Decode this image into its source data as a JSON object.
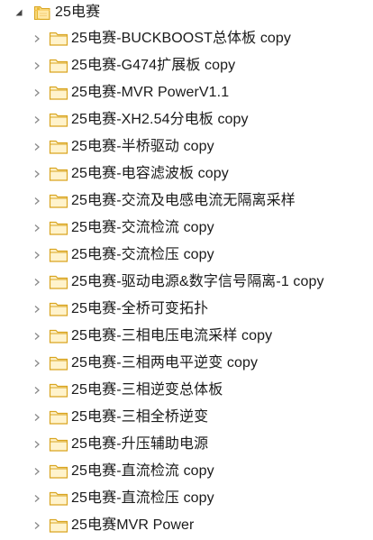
{
  "tree": {
    "root": {
      "label": "25电赛",
      "expanded": true,
      "icon": "folder-open-icon"
    },
    "children": [
      {
        "label": "25电赛-BUCKBOOST总体板 copy"
      },
      {
        "label": "25电赛-G474扩展板 copy"
      },
      {
        "label": "25电赛-MVR PowerV1.1"
      },
      {
        "label": "25电赛-XH2.54分电板 copy"
      },
      {
        "label": "25电赛-半桥驱动 copy"
      },
      {
        "label": "25电赛-电容滤波板 copy"
      },
      {
        "label": "25电赛-交流及电感电流无隔离采样"
      },
      {
        "label": "25电赛-交流检流 copy"
      },
      {
        "label": "25电赛-交流检压 copy"
      },
      {
        "label": "25电赛-驱动电源&数字信号隔离-1 copy"
      },
      {
        "label": "25电赛-全桥可变拓扑"
      },
      {
        "label": "25电赛-三相电压电流采样 copy"
      },
      {
        "label": "25电赛-三相两电平逆变 copy"
      },
      {
        "label": "25电赛-三相逆变总体板"
      },
      {
        "label": "25电赛-三相全桥逆变"
      },
      {
        "label": "25电赛-升压辅助电源"
      },
      {
        "label": "25电赛-直流检流 copy"
      },
      {
        "label": "25电赛-直流检压 copy"
      },
      {
        "label": "25电赛MVR Power"
      }
    ],
    "colors": {
      "text": "#1a1a1a",
      "expander": "#8a8a8a",
      "folder_fill": "#fff3cc",
      "folder_stroke": "#d9a520",
      "folder_open_fill": "#f5c24a"
    }
  }
}
